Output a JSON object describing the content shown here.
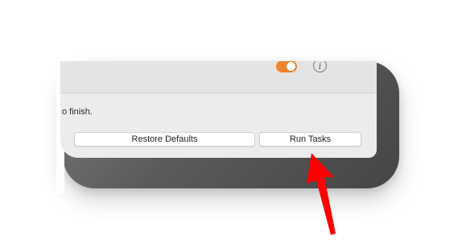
{
  "window": {
    "status_text": "o finish.",
    "restore_label": "Restore Defaults",
    "run_label": "Run Tasks",
    "info_glyph": "i"
  },
  "toggle": {
    "state": "on",
    "accent_color": "#f0842c"
  },
  "icons": {
    "info": "info-circle-icon",
    "arrow": "red-pointer-arrow-icon"
  },
  "colors": {
    "annotation_arrow": "#ff0000",
    "window_background": "#ececec"
  }
}
